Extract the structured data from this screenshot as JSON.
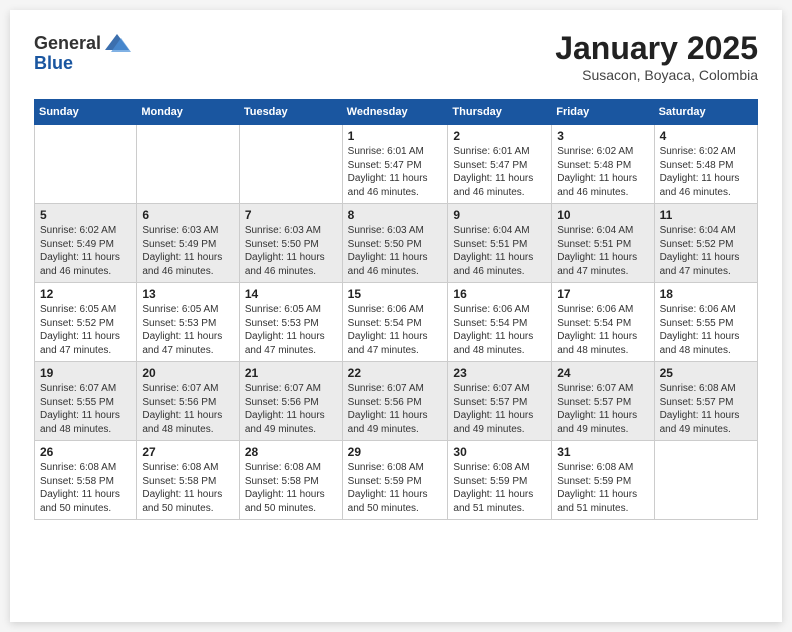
{
  "logo": {
    "general": "General",
    "blue": "Blue"
  },
  "header": {
    "month": "January 2025",
    "location": "Susacon, Boyaca, Colombia"
  },
  "weekdays": [
    "Sunday",
    "Monday",
    "Tuesday",
    "Wednesday",
    "Thursday",
    "Friday",
    "Saturday"
  ],
  "rows": [
    [
      {
        "day": "",
        "info": ""
      },
      {
        "day": "",
        "info": ""
      },
      {
        "day": "",
        "info": ""
      },
      {
        "day": "1",
        "info": "Sunrise: 6:01 AM\nSunset: 5:47 PM\nDaylight: 11 hours and 46 minutes."
      },
      {
        "day": "2",
        "info": "Sunrise: 6:01 AM\nSunset: 5:47 PM\nDaylight: 11 hours and 46 minutes."
      },
      {
        "day": "3",
        "info": "Sunrise: 6:02 AM\nSunset: 5:48 PM\nDaylight: 11 hours and 46 minutes."
      },
      {
        "day": "4",
        "info": "Sunrise: 6:02 AM\nSunset: 5:48 PM\nDaylight: 11 hours and 46 minutes."
      }
    ],
    [
      {
        "day": "5",
        "info": "Sunrise: 6:02 AM\nSunset: 5:49 PM\nDaylight: 11 hours and 46 minutes."
      },
      {
        "day": "6",
        "info": "Sunrise: 6:03 AM\nSunset: 5:49 PM\nDaylight: 11 hours and 46 minutes."
      },
      {
        "day": "7",
        "info": "Sunrise: 6:03 AM\nSunset: 5:50 PM\nDaylight: 11 hours and 46 minutes."
      },
      {
        "day": "8",
        "info": "Sunrise: 6:03 AM\nSunset: 5:50 PM\nDaylight: 11 hours and 46 minutes."
      },
      {
        "day": "9",
        "info": "Sunrise: 6:04 AM\nSunset: 5:51 PM\nDaylight: 11 hours and 46 minutes."
      },
      {
        "day": "10",
        "info": "Sunrise: 6:04 AM\nSunset: 5:51 PM\nDaylight: 11 hours and 47 minutes."
      },
      {
        "day": "11",
        "info": "Sunrise: 6:04 AM\nSunset: 5:52 PM\nDaylight: 11 hours and 47 minutes."
      }
    ],
    [
      {
        "day": "12",
        "info": "Sunrise: 6:05 AM\nSunset: 5:52 PM\nDaylight: 11 hours and 47 minutes."
      },
      {
        "day": "13",
        "info": "Sunrise: 6:05 AM\nSunset: 5:53 PM\nDaylight: 11 hours and 47 minutes."
      },
      {
        "day": "14",
        "info": "Sunrise: 6:05 AM\nSunset: 5:53 PM\nDaylight: 11 hours and 47 minutes."
      },
      {
        "day": "15",
        "info": "Sunrise: 6:06 AM\nSunset: 5:54 PM\nDaylight: 11 hours and 47 minutes."
      },
      {
        "day": "16",
        "info": "Sunrise: 6:06 AM\nSunset: 5:54 PM\nDaylight: 11 hours and 48 minutes."
      },
      {
        "day": "17",
        "info": "Sunrise: 6:06 AM\nSunset: 5:54 PM\nDaylight: 11 hours and 48 minutes."
      },
      {
        "day": "18",
        "info": "Sunrise: 6:06 AM\nSunset: 5:55 PM\nDaylight: 11 hours and 48 minutes."
      }
    ],
    [
      {
        "day": "19",
        "info": "Sunrise: 6:07 AM\nSunset: 5:55 PM\nDaylight: 11 hours and 48 minutes."
      },
      {
        "day": "20",
        "info": "Sunrise: 6:07 AM\nSunset: 5:56 PM\nDaylight: 11 hours and 48 minutes."
      },
      {
        "day": "21",
        "info": "Sunrise: 6:07 AM\nSunset: 5:56 PM\nDaylight: 11 hours and 49 minutes."
      },
      {
        "day": "22",
        "info": "Sunrise: 6:07 AM\nSunset: 5:56 PM\nDaylight: 11 hours and 49 minutes."
      },
      {
        "day": "23",
        "info": "Sunrise: 6:07 AM\nSunset: 5:57 PM\nDaylight: 11 hours and 49 minutes."
      },
      {
        "day": "24",
        "info": "Sunrise: 6:07 AM\nSunset: 5:57 PM\nDaylight: 11 hours and 49 minutes."
      },
      {
        "day": "25",
        "info": "Sunrise: 6:08 AM\nSunset: 5:57 PM\nDaylight: 11 hours and 49 minutes."
      }
    ],
    [
      {
        "day": "26",
        "info": "Sunrise: 6:08 AM\nSunset: 5:58 PM\nDaylight: 11 hours and 50 minutes."
      },
      {
        "day": "27",
        "info": "Sunrise: 6:08 AM\nSunset: 5:58 PM\nDaylight: 11 hours and 50 minutes."
      },
      {
        "day": "28",
        "info": "Sunrise: 6:08 AM\nSunset: 5:58 PM\nDaylight: 11 hours and 50 minutes."
      },
      {
        "day": "29",
        "info": "Sunrise: 6:08 AM\nSunset: 5:59 PM\nDaylight: 11 hours and 50 minutes."
      },
      {
        "day": "30",
        "info": "Sunrise: 6:08 AM\nSunset: 5:59 PM\nDaylight: 11 hours and 51 minutes."
      },
      {
        "day": "31",
        "info": "Sunrise: 6:08 AM\nSunset: 5:59 PM\nDaylight: 11 hours and 51 minutes."
      },
      {
        "day": "",
        "info": ""
      }
    ]
  ]
}
